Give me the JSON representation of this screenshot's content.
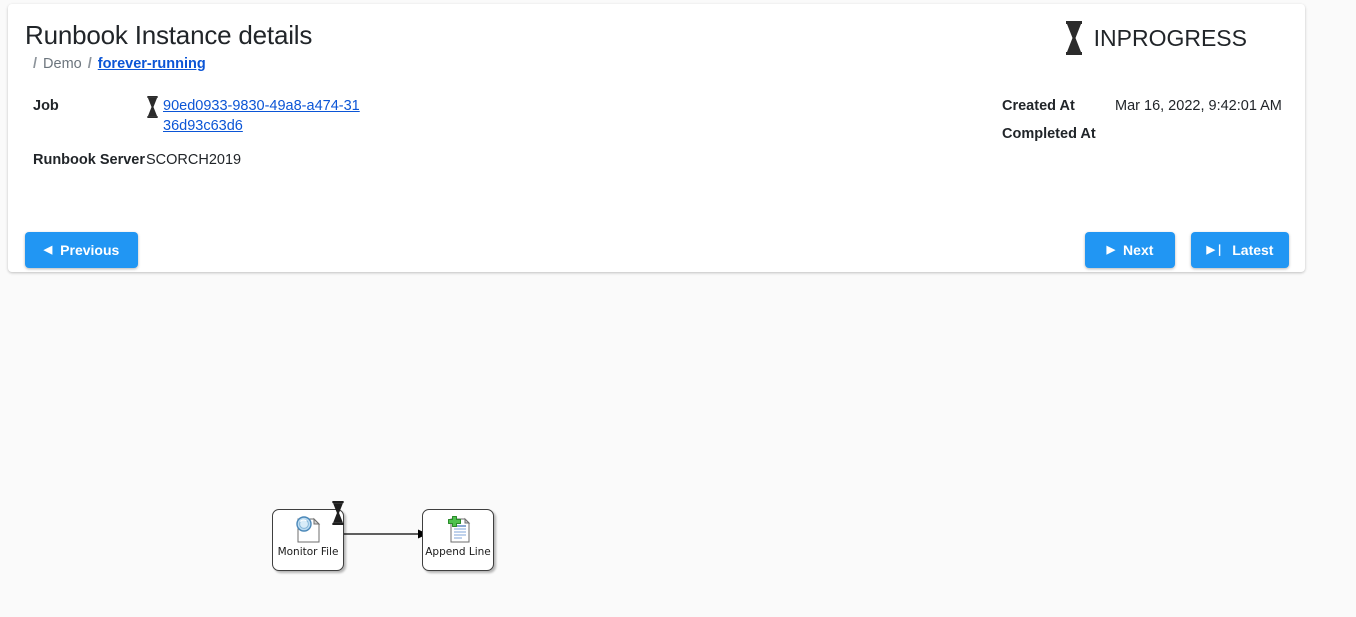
{
  "header": {
    "title": "Runbook Instance details",
    "breadcrumb": {
      "sep1": "/",
      "folder": "Demo",
      "sep2": "/",
      "current": "forever-running"
    },
    "status": {
      "label": "INPROGRESS",
      "icon": "hourglass-icon"
    }
  },
  "details": {
    "job_label": "Job",
    "job_value": "90ed0933-9830-49a8-a474-3136d93c63d6",
    "runbook_server_label": "Runbook Server",
    "runbook_server_value": "SCORCH2019",
    "created_at_label": "Created At",
    "created_at_value": "Mar 16, 2022, 9:42:01 AM",
    "completed_at_label": "Completed At",
    "completed_at_value": ""
  },
  "toolbar": {
    "previous_label": "Previous",
    "previous_glyph": "◀",
    "next_label": "Next",
    "next_glyph": "▶",
    "latest_label": "Latest",
    "latest_glyph": "▶❘"
  },
  "diagram": {
    "nodes": [
      {
        "id": "monitor-file",
        "label": "Monitor File",
        "icon": "document-watch-icon",
        "running": true
      },
      {
        "id": "append-line",
        "label": "Append Line",
        "icon": "document-add-icon",
        "running": false
      }
    ],
    "edges": [
      {
        "from": "monitor-file",
        "to": "append-line"
      }
    ]
  },
  "colors": {
    "accent_blue": "#2196f3",
    "link_blue": "#0b55d6",
    "page_background": "#fafafa",
    "card_background": "#ffffff",
    "muted_text": "#6c757d",
    "node_plus_green": "#3fb63f"
  }
}
